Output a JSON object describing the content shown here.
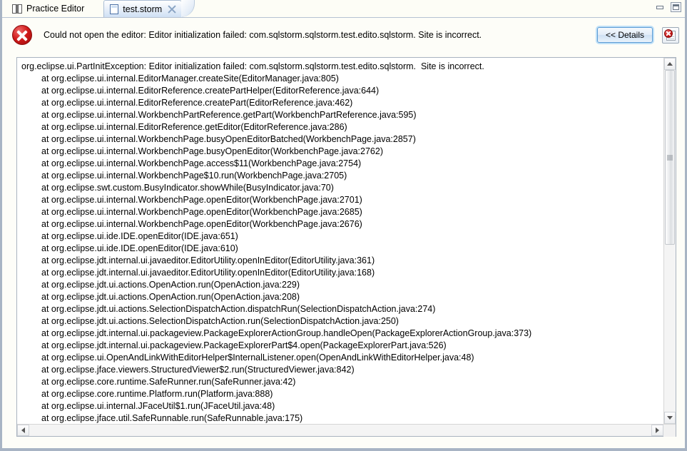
{
  "window": {
    "minimize_label": "minimize",
    "maximize_label": "maximize"
  },
  "tabs": [
    {
      "label": "Practice Editor",
      "icon": "book-icon",
      "active": false,
      "closable": false
    },
    {
      "label": "test.storm",
      "icon": "document-icon",
      "active": true,
      "closable": true
    }
  ],
  "error_bar": {
    "icon": "error-circle-icon",
    "message": "Could not open the editor: Editor initialization failed: com.sqlstorm.sqlstorm.test.edito.sqlstorm.  Site is incorrect.",
    "details_label": "<< Details",
    "log_button_icon": "error-log-icon"
  },
  "trace": {
    "header": "org.eclipse.ui.PartInitException: Editor initialization failed: com.sqlstorm.sqlstorm.test.edito.sqlstorm.  Site is incorrect.",
    "lines": [
      "at org.eclipse.ui.internal.EditorManager.createSite(EditorManager.java:805)",
      "at org.eclipse.ui.internal.EditorReference.createPartHelper(EditorReference.java:644)",
      "at org.eclipse.ui.internal.EditorReference.createPart(EditorReference.java:462)",
      "at org.eclipse.ui.internal.WorkbenchPartReference.getPart(WorkbenchPartReference.java:595)",
      "at org.eclipse.ui.internal.EditorReference.getEditor(EditorReference.java:286)",
      "at org.eclipse.ui.internal.WorkbenchPage.busyOpenEditorBatched(WorkbenchPage.java:2857)",
      "at org.eclipse.ui.internal.WorkbenchPage.busyOpenEditor(WorkbenchPage.java:2762)",
      "at org.eclipse.ui.internal.WorkbenchPage.access$11(WorkbenchPage.java:2754)",
      "at org.eclipse.ui.internal.WorkbenchPage$10.run(WorkbenchPage.java:2705)",
      "at org.eclipse.swt.custom.BusyIndicator.showWhile(BusyIndicator.java:70)",
      "at org.eclipse.ui.internal.WorkbenchPage.openEditor(WorkbenchPage.java:2701)",
      "at org.eclipse.ui.internal.WorkbenchPage.openEditor(WorkbenchPage.java:2685)",
      "at org.eclipse.ui.internal.WorkbenchPage.openEditor(WorkbenchPage.java:2676)",
      "at org.eclipse.ui.ide.IDE.openEditor(IDE.java:651)",
      "at org.eclipse.ui.ide.IDE.openEditor(IDE.java:610)",
      "at org.eclipse.jdt.internal.ui.javaeditor.EditorUtility.openInEditor(EditorUtility.java:361)",
      "at org.eclipse.jdt.internal.ui.javaeditor.EditorUtility.openInEditor(EditorUtility.java:168)",
      "at org.eclipse.jdt.ui.actions.OpenAction.run(OpenAction.java:229)",
      "at org.eclipse.jdt.ui.actions.OpenAction.run(OpenAction.java:208)",
      "at org.eclipse.jdt.ui.actions.SelectionDispatchAction.dispatchRun(SelectionDispatchAction.java:274)",
      "at org.eclipse.jdt.ui.actions.SelectionDispatchAction.run(SelectionDispatchAction.java:250)",
      "at org.eclipse.jdt.internal.ui.packageview.PackageExplorerActionGroup.handleOpen(PackageExplorerActionGroup.java:373)",
      "at org.eclipse.jdt.internal.ui.packageview.PackageExplorerPart$4.open(PackageExplorerPart.java:526)",
      "at org.eclipse.ui.OpenAndLinkWithEditorHelper$InternalListener.open(OpenAndLinkWithEditorHelper.java:48)",
      "at org.eclipse.jface.viewers.StructuredViewer$2.run(StructuredViewer.java:842)",
      "at org.eclipse.core.runtime.SafeRunner.run(SafeRunner.java:42)",
      "at org.eclipse.core.runtime.Platform.run(Platform.java:888)",
      "at org.eclipse.ui.internal.JFaceUtil$1.run(JFaceUtil.java:48)",
      "at org.eclipse.jface.util.SafeRunnable.run(SafeRunnable.java:175)"
    ]
  },
  "scrollbars": {
    "vertical": {
      "up_icon": "arrow-up-icon",
      "down_icon": "arrow-down-icon",
      "thumb_icon": "scroll-thumb"
    },
    "horizontal": {
      "left_icon": "arrow-left-icon",
      "right_icon": "arrow-right-icon"
    }
  },
  "colors": {
    "error_red": "#d01a1a",
    "accent_blue": "#5b9bd5",
    "frame": "#a8b4c4"
  }
}
